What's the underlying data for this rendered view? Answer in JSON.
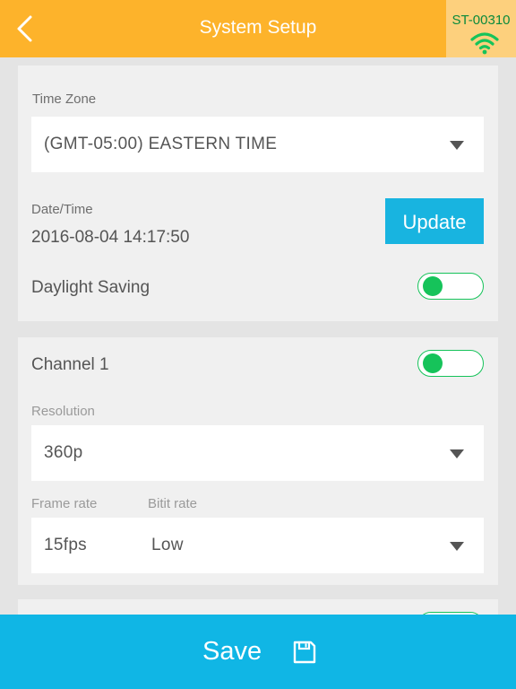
{
  "header": {
    "title": "System Setup",
    "device_id": "ST-00310",
    "background": "#fdb32b",
    "icons": {
      "back": "chevron-left-icon",
      "wifi": "wifi-icon"
    }
  },
  "time_settings": {
    "time_zone_label": "Time Zone",
    "time_zone_value": "(GMT-05:00) EASTERN TIME",
    "date_time_label": "Date/Time",
    "date_time_value": "2016-08-04 14:17:50",
    "update_label": "Update",
    "daylight_saving_label": "Daylight Saving",
    "daylight_saving_on": true
  },
  "channel_1": {
    "label": "Channel 1",
    "enabled": true,
    "resolution_label": "Resolution",
    "resolution_value": "360p",
    "frame_rate_label": "Frame rate",
    "frame_rate_value": "15fps",
    "bit_rate_label": "Bitit rate",
    "bit_rate_value": "Low"
  },
  "footer": {
    "save_label": "Save",
    "save_icon": "floppy-disk-icon",
    "background": "#10b6e5"
  },
  "colors": {
    "accent_green": "#16c35a",
    "update_blue": "#18b4e0"
  }
}
